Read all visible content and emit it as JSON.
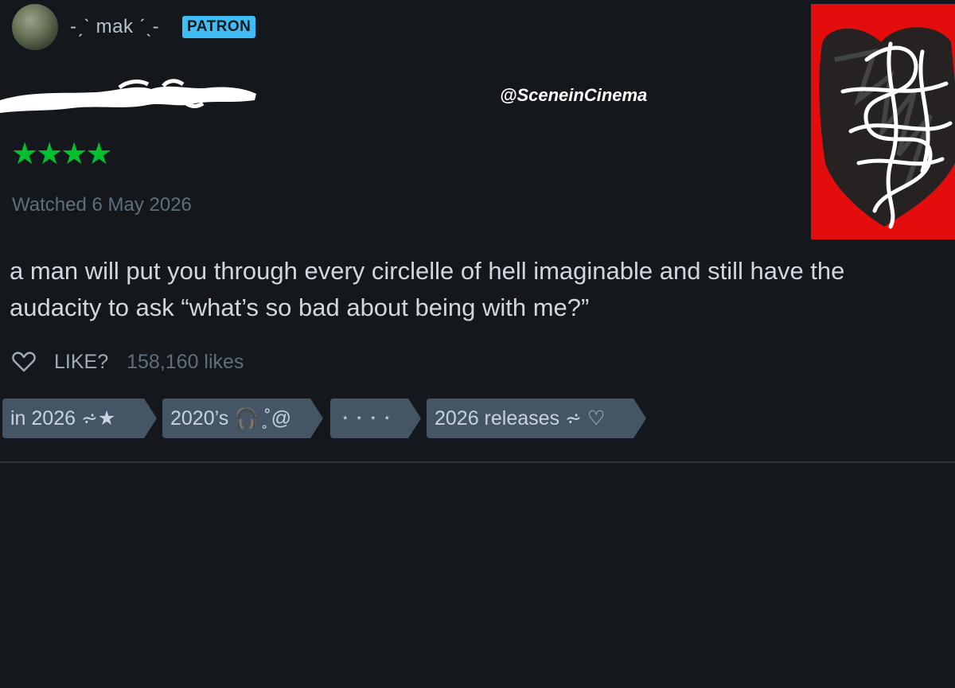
{
  "header": {
    "username": "-ˏˋ mak ˊˎ-",
    "badge": "PATRON"
  },
  "watermark": "@SceneinCinema",
  "review": {
    "rating": "★★★★",
    "watched": "Watched 6 May 2026",
    "text": "a man will put you through every circlelle of hell imaginable and still have the audacity to ask “what’s so bad about being with me?”"
  },
  "likes": {
    "label": "LIKE?",
    "count": "158,160 likes"
  },
  "tags": [
    {
      "label": "in 2026 ⩫★"
    },
    {
      "label": "2020’s 🎧 ̥˚@"
    },
    {
      "label": "⋆ ⋆ ⋆ ⋆"
    },
    {
      "label": "2026 releases ⩫ ♡"
    }
  ],
  "colors": {
    "background": "#14181c",
    "star": "#00c030",
    "badge": "#40bcf4",
    "tag": "#445566",
    "poster": "#e30d0d"
  }
}
